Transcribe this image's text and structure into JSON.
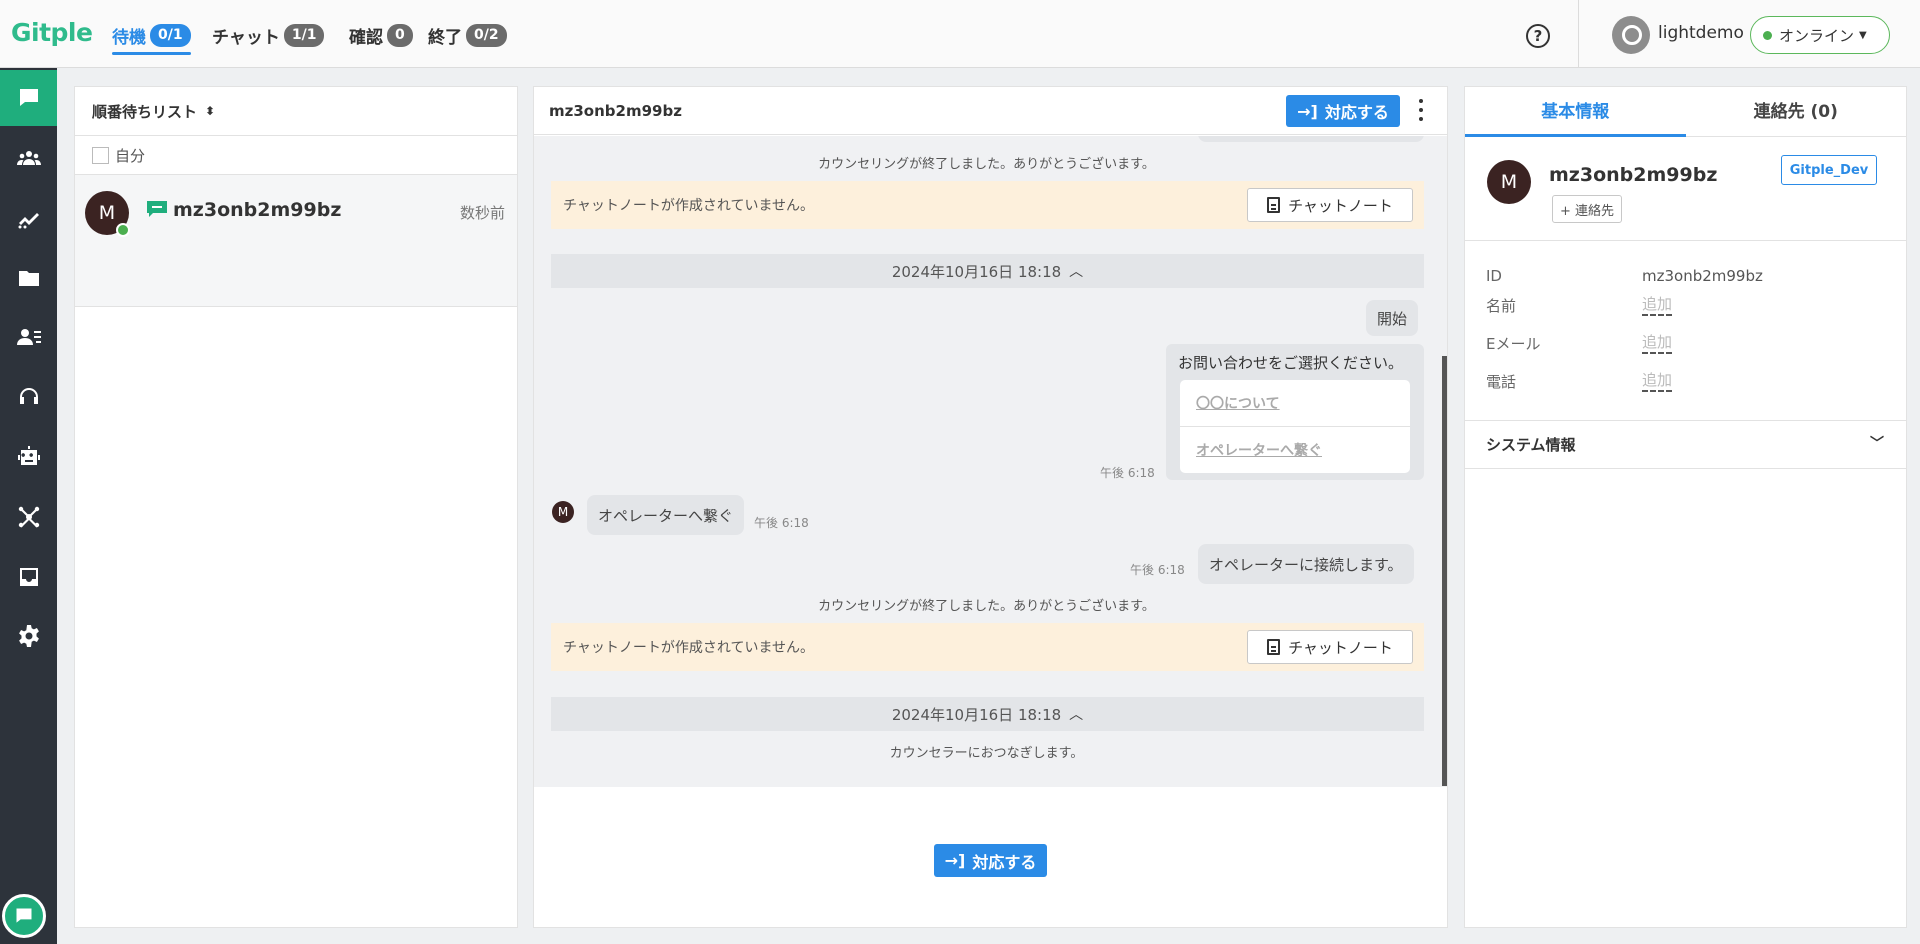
{
  "header": {
    "logo": "Gitple",
    "tabs": [
      {
        "label": "待機",
        "badge": "0/1",
        "active": true
      },
      {
        "label": "チャット",
        "badge": "1/1"
      },
      {
        "label": "確認",
        "badge": "0"
      },
      {
        "label": "終了",
        "badge": "0/2"
      }
    ],
    "help_icon": "?",
    "user_name": "lightdemo",
    "status": "オンライン",
    "status_color": "#4caf50"
  },
  "sidebar": {
    "items": [
      "chat-icon",
      "users-icon",
      "analytics-icon",
      "folder-icon",
      "contacts-icon",
      "headset-icon",
      "bot-icon",
      "network-icon",
      "inbox-icon",
      "gear-icon"
    ],
    "active_index": 0,
    "accent": "#1fae7d"
  },
  "queue": {
    "title": "順番待ちリスト",
    "filter_label": "自分",
    "items": [
      {
        "initial": "M",
        "name": "mz3onb2m99bz",
        "time": "数秒前"
      }
    ]
  },
  "chat": {
    "title": "mz3onb2m99bz",
    "accept_label": "対応する",
    "messages": {
      "end_notice_1": "カウンセリングが終了しました。ありがとうございます。",
      "note_missing_1": "チャットノートが作成されていません。",
      "note_button": "チャットノート",
      "date_1": "2024年10月16日 18:18",
      "start": "開始",
      "card_title": "お問い合わせをご選択ください。",
      "card_options": [
        "〇〇について",
        "オペレーターへ繋ぐ"
      ],
      "card_time": "午後 6:18",
      "user_initial": "M",
      "user_msg": "オペレーターへ繋ぐ",
      "user_time": "午後 6:18",
      "bot_time": "午後 6:18",
      "bot_msg": "オペレーターに接続します。",
      "end_notice_2": "カウンセリングが終了しました。ありがとうございます。",
      "note_missing_2": "チャットノートが作成されていません。",
      "date_2": "2024年10月16日 18:18",
      "connecting": "カウンセラーにおつなぎします。"
    },
    "footer_accept_label": "対応する"
  },
  "info": {
    "tabs": [
      "基本情報",
      "連絡先 (0)"
    ],
    "name": "mz3onb2m99bz",
    "initial": "M",
    "add_contact": "+ 連絡先",
    "tag": "Gitple_Dev",
    "fields": [
      {
        "label": "ID",
        "value": "mz3onb2m99bz"
      },
      {
        "label": "名前",
        "value": "追加"
      },
      {
        "label": "Eメール",
        "value": "追加"
      },
      {
        "label": "電話",
        "value": "追加"
      }
    ],
    "system_info": "システム情報"
  }
}
